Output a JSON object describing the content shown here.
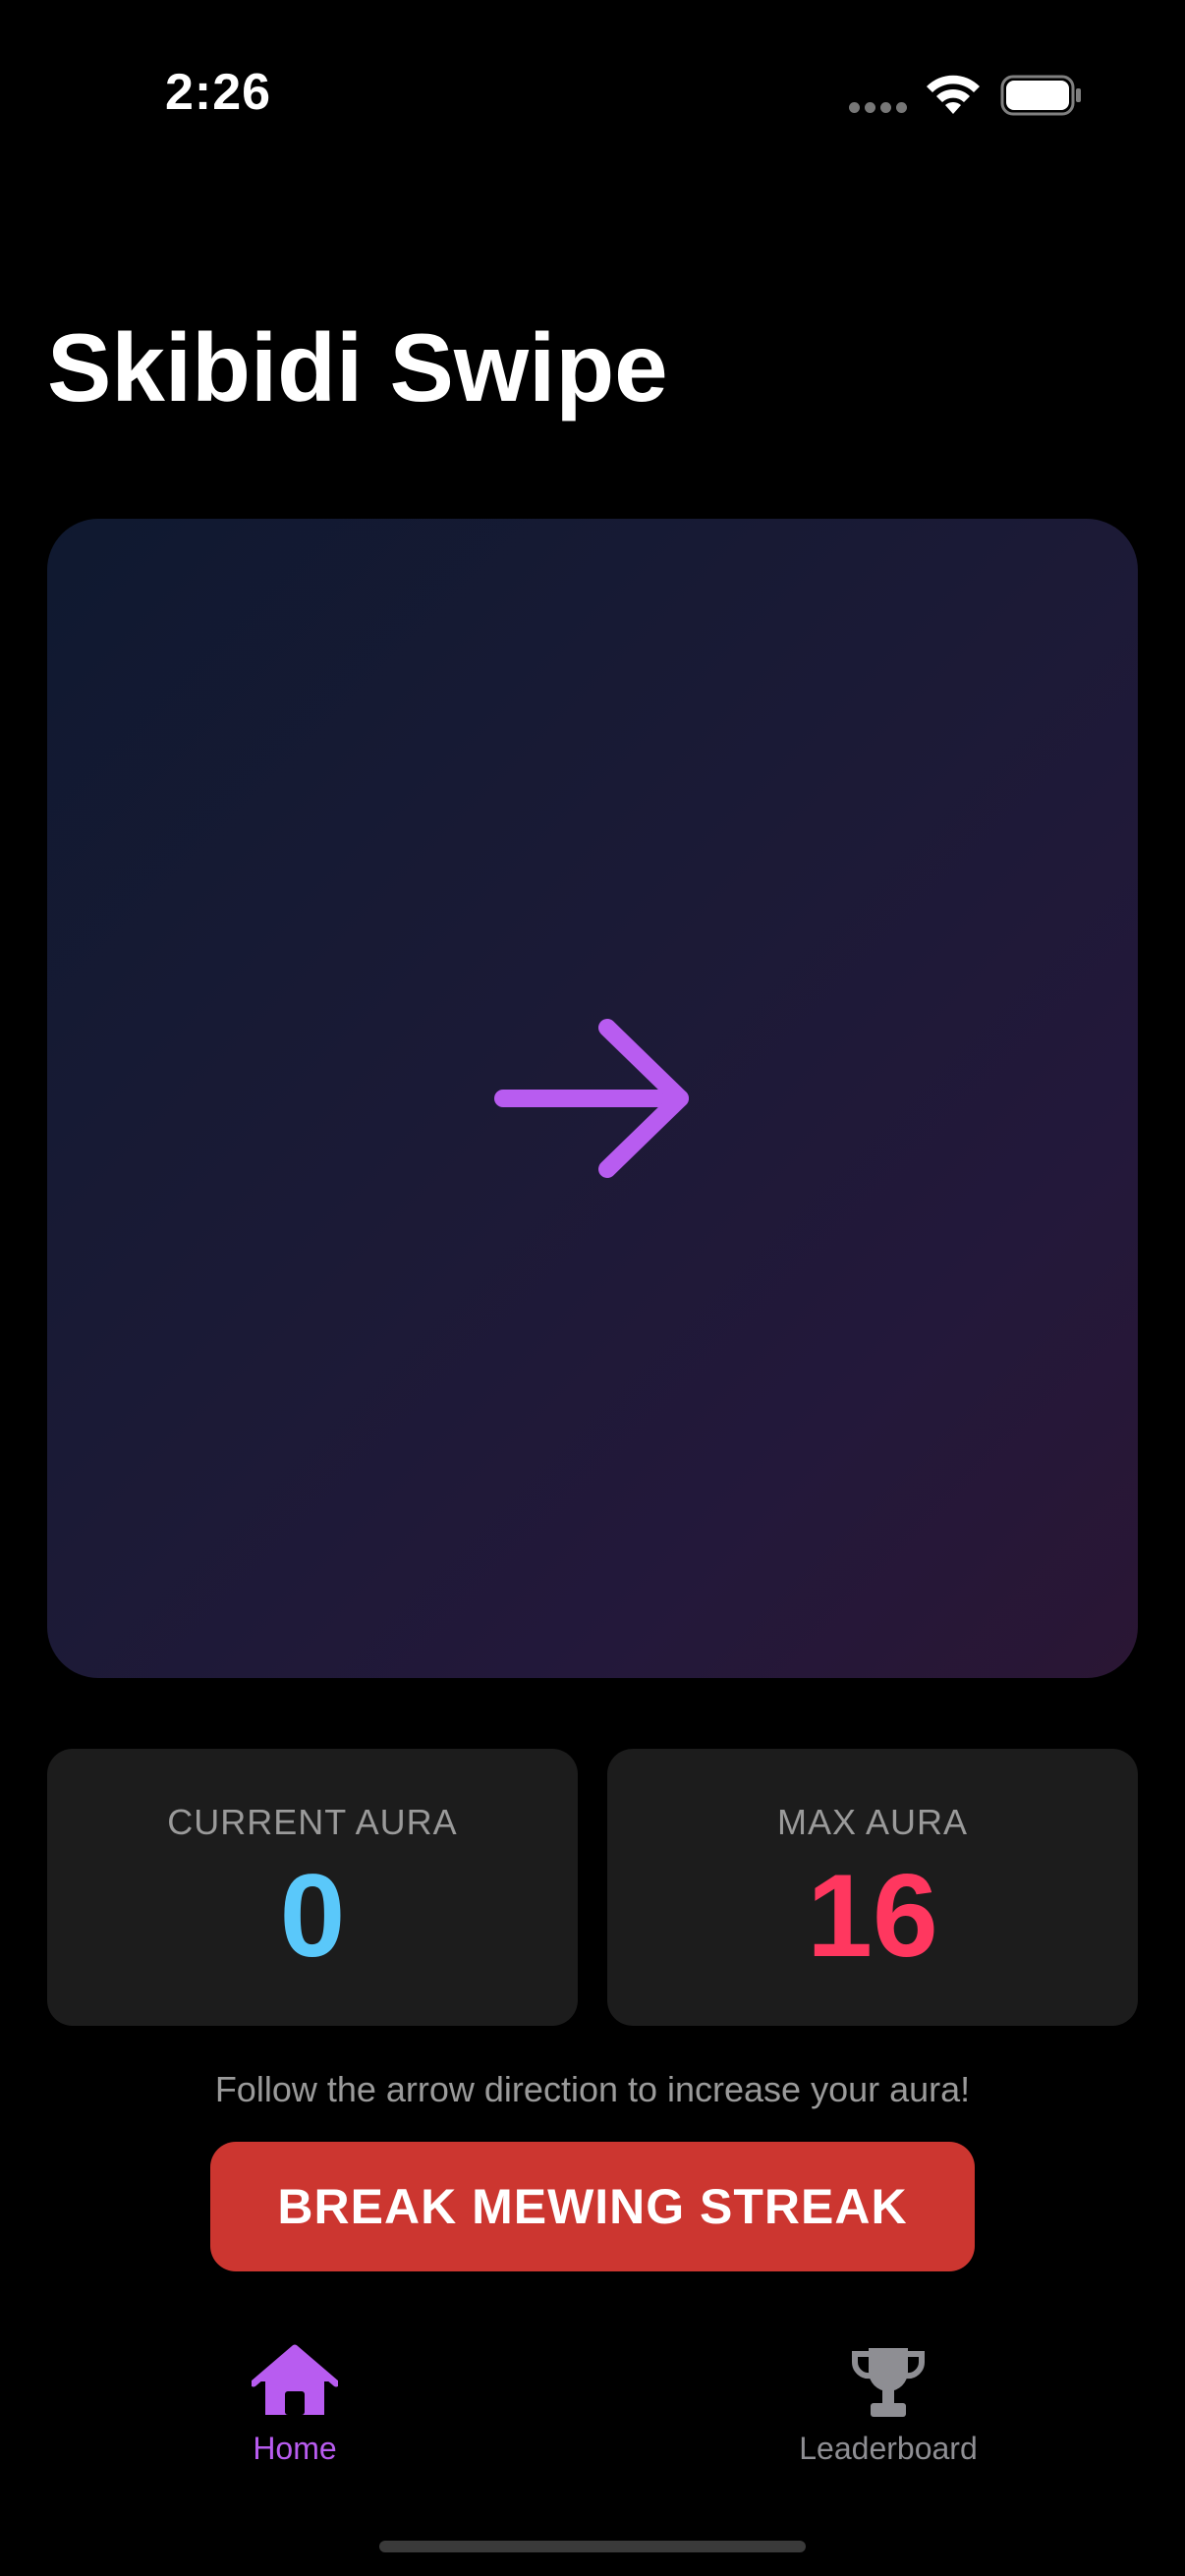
{
  "status_bar": {
    "time": "2:26"
  },
  "app": {
    "title": "Skibidi Swipe"
  },
  "game": {
    "arrow_direction": "right",
    "arrow_color": "#b85cf0"
  },
  "stats": {
    "current": {
      "label": "CURRENT AURA",
      "value": "0",
      "color": "#5ac8fa"
    },
    "max": {
      "label": "MAX AURA",
      "value": "16",
      "color": "#ff375f"
    }
  },
  "hint": "Follow the arrow direction to increase your aura!",
  "action_button": {
    "label": "BREAK MEWING STREAK",
    "color": "#cc3630"
  },
  "tab_bar": {
    "active_color": "#b85cf0",
    "inactive_color": "#8e8e93",
    "tabs": [
      {
        "label": "Home",
        "icon": "house-icon",
        "active": true
      },
      {
        "label": "Leaderboard",
        "icon": "trophy-icon",
        "active": false
      }
    ]
  }
}
